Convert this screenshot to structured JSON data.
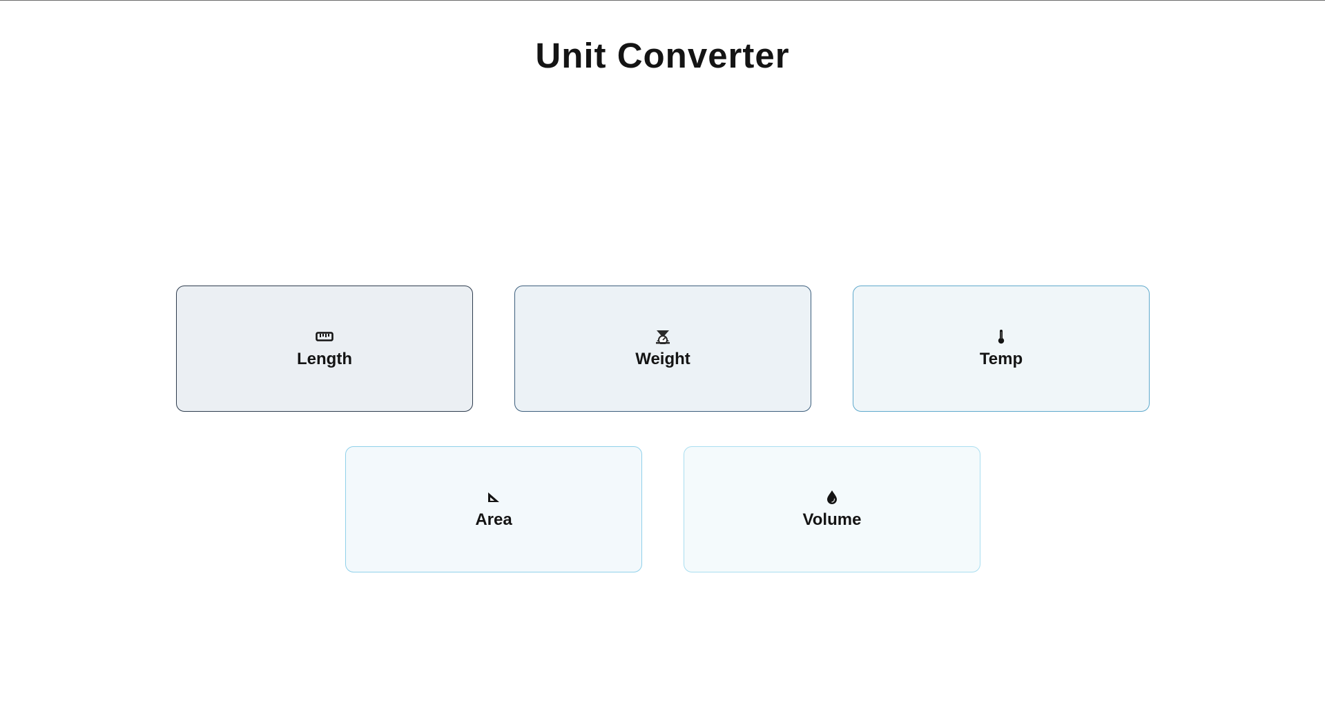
{
  "page": {
    "title": "Unit Converter"
  },
  "categories": [
    {
      "label": "Length",
      "icon": "ruler-icon"
    },
    {
      "label": "Weight",
      "icon": "scale-icon"
    },
    {
      "label": "Temp",
      "icon": "thermometer-icon"
    },
    {
      "label": "Area",
      "icon": "triangle-ruler-icon"
    },
    {
      "label": "Volume",
      "icon": "droplet-icon"
    }
  ],
  "colors": {
    "text": "#141414",
    "card_gradient_start": "#ebeff3",
    "card_gradient_end": "#f4fafc",
    "border_dark": "#2c3a4c",
    "border_light": "#a9def0"
  }
}
